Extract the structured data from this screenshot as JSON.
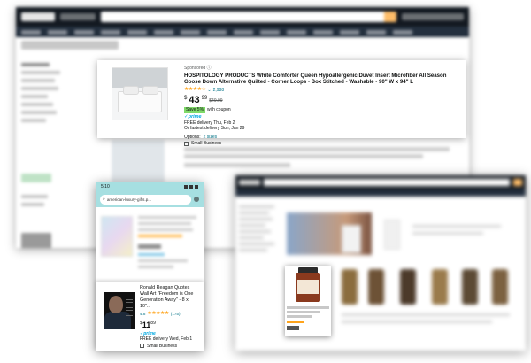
{
  "main_card": {
    "sponsored": "Sponsored ⓘ",
    "title": "HOSPITOLOGY PRODUCTS White Comforter Queen Hypoallergenic Duvet Insert Microfiber All Season Goose Down Alternative Quilted - Corner Loops - Box Stitched - Washable - 90\" W x 94\" L",
    "stars": "★★★★☆",
    "rating_count": "2,988",
    "price_symbol": "$",
    "price_whole": "43",
    "price_fraction": "99",
    "list_price": "$49.99",
    "coupon_badge": "Save 5%",
    "coupon_text": "with coupon",
    "prime": "✓prime",
    "delivery": "FREE delivery Thu, Feb 2",
    "fastest": "Or fastest delivery Sun, Jan 29",
    "options_label": "Options:",
    "options_link": "2 sizes",
    "small_business": "Small Business"
  },
  "phone": {
    "time": "5:10",
    "address": "american-luxury-gifts.p...",
    "card": {
      "title": "Ronald Reagan Quotes Wall Art \"Freedom is One Generation Away\" - 8 x 10\"...",
      "rating_value": "4.8",
      "stars": "★★★★★",
      "rating_count": "(175)",
      "price_symbol": "$",
      "price_whole": "11",
      "price_fraction": "89",
      "prime": "✓prime",
      "delivery": "FREE delivery Wed, Feb 1",
      "small_business": "Small Business"
    }
  },
  "colors": {
    "amazon_dark": "#131921",
    "amazon_nav": "#232f3e",
    "search_button": "#febd69",
    "star": "#ffa41c",
    "link": "#007185",
    "prime": "#00a8e1",
    "coupon": "#7fda69",
    "phone_bar": "#a6dfe1"
  }
}
